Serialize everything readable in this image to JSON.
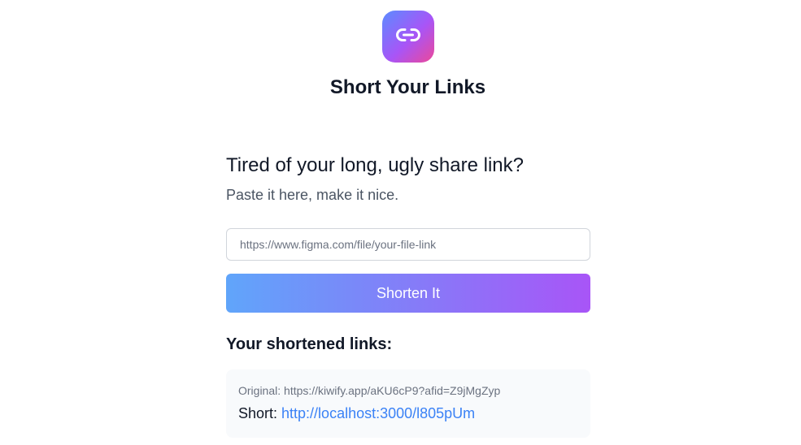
{
  "app": {
    "icon": "link-icon",
    "title": "Short Your Links",
    "brand_gradient": [
      "#5b8cff",
      "#a855f7",
      "#ec4899"
    ]
  },
  "hero": {
    "headline": "Tired of your long, ugly share link?",
    "subline": "Paste it here, make it nice."
  },
  "form": {
    "url_input": {
      "value": "",
      "placeholder": "https://www.figma.com/file/your-file-link"
    },
    "submit_label": "Shorten It",
    "button_gradient": [
      "#60a5fa",
      "#a855f7"
    ]
  },
  "results": {
    "heading": "Your shortened links:",
    "items": [
      {
        "original_prefix": "Original: ",
        "original_url": "https://kiwify.app/aKU6cP9?afid=Z9jMgZyp",
        "short_prefix": "Short: ",
        "short_url": "http://localhost:3000/l805pUm"
      }
    ]
  },
  "colors": {
    "link": "#3b82f6",
    "text_primary": "#111827",
    "text_secondary": "#6b7280",
    "card_background": "#f8fafc"
  }
}
